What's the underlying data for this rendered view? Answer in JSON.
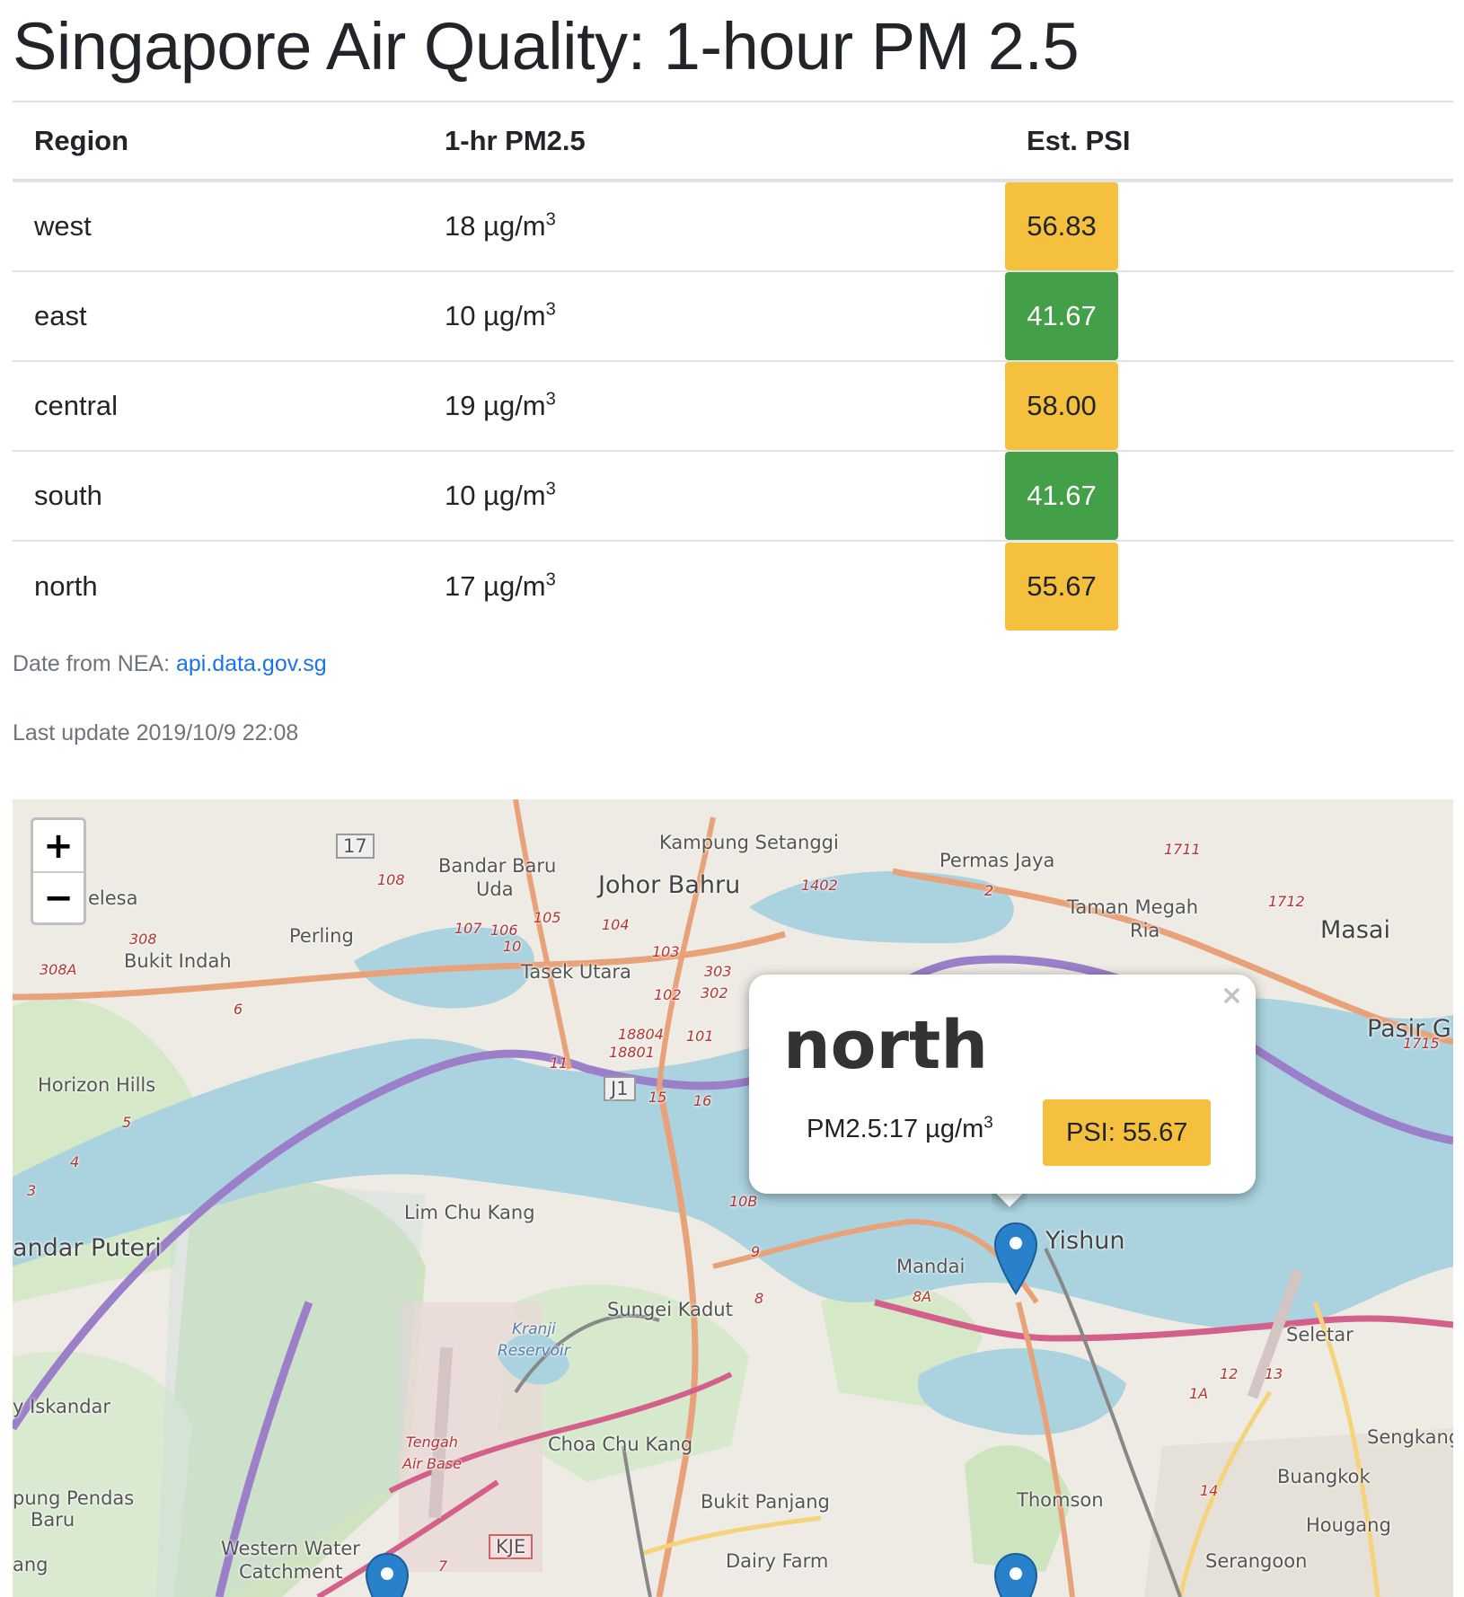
{
  "page": {
    "title": "Singapore Air Quality: 1-hour PM 2.5"
  },
  "table": {
    "headers": {
      "region": "Region",
      "pm": "1-hr PM2.5",
      "psi": "Est. PSI"
    },
    "unit": "µg/m",
    "unit_superscript": "3",
    "rows": [
      {
        "region": "west",
        "pm": "18 µg/m",
        "psi": "56.83",
        "level": "moderate"
      },
      {
        "region": "east",
        "pm": "10 µg/m",
        "psi": "41.67",
        "level": "good"
      },
      {
        "region": "central",
        "pm": "19 µg/m",
        "psi": "58.00",
        "level": "moderate"
      },
      {
        "region": "south",
        "pm": "10 µg/m",
        "psi": "41.67",
        "level": "good"
      },
      {
        "region": "north",
        "pm": "17 µg/m",
        "psi": "55.67",
        "level": "moderate"
      }
    ]
  },
  "footer": {
    "source_prefix": "Date from NEA: ",
    "source_link": "api.data.gov.sg",
    "last_update": "Last update 2019/10/9 22:08"
  },
  "colors": {
    "moderate": "#f4c03d",
    "good": "#44a048",
    "link": "#1a73e8",
    "marker": "#2a81cb"
  },
  "map": {
    "zoom_in": "+",
    "zoom_out": "−",
    "labels": [
      "Kampung Setanggi",
      "Bandar Baru",
      "Uda",
      "Johor Bahru",
      "Permas Jaya",
      "Taman Megah",
      "Ria",
      "Masai",
      "Perling",
      "Bukit Indah",
      "Tasek Utara",
      "Pasir G",
      "Horizon Hills",
      "Lim Chu Kang",
      "andar Puteri",
      "Sungei Kadut",
      "Mandai",
      "Yishun",
      "Seletar",
      "Kranji",
      "Reservoir",
      "y Iskandar",
      "Tengah",
      "Air Base",
      "Choa Chu Kang",
      "Sengkang",
      "Buangkok",
      "Thomson",
      "Hougang",
      "pung Pendas",
      "Baru",
      "Bukit Panjang",
      "Western Water",
      "Catchment",
      "Dairy Farm",
      "Serangoon",
      "KJE",
      "J1",
      "17",
      "elesa",
      "ang"
    ],
    "road_numbers": [
      "108",
      "107",
      "106",
      "105",
      "104",
      "103",
      "303",
      "302",
      "102",
      "101",
      "18804",
      "18801",
      "15",
      "16",
      "11",
      "10",
      "6",
      "5",
      "4",
      "3",
      "2",
      "308",
      "308A",
      "1402",
      "1711",
      "1712",
      "1715",
      "10B",
      "9",
      "8",
      "8A",
      "7",
      "12",
      "13",
      "14",
      "1A"
    ],
    "popup": {
      "close": "×",
      "title": "north",
      "pm": "PM2.5:17 µg/m",
      "pm_superscript": "3",
      "psi": "PSI: 55.67"
    },
    "marker_icon": "map-marker-icon"
  }
}
